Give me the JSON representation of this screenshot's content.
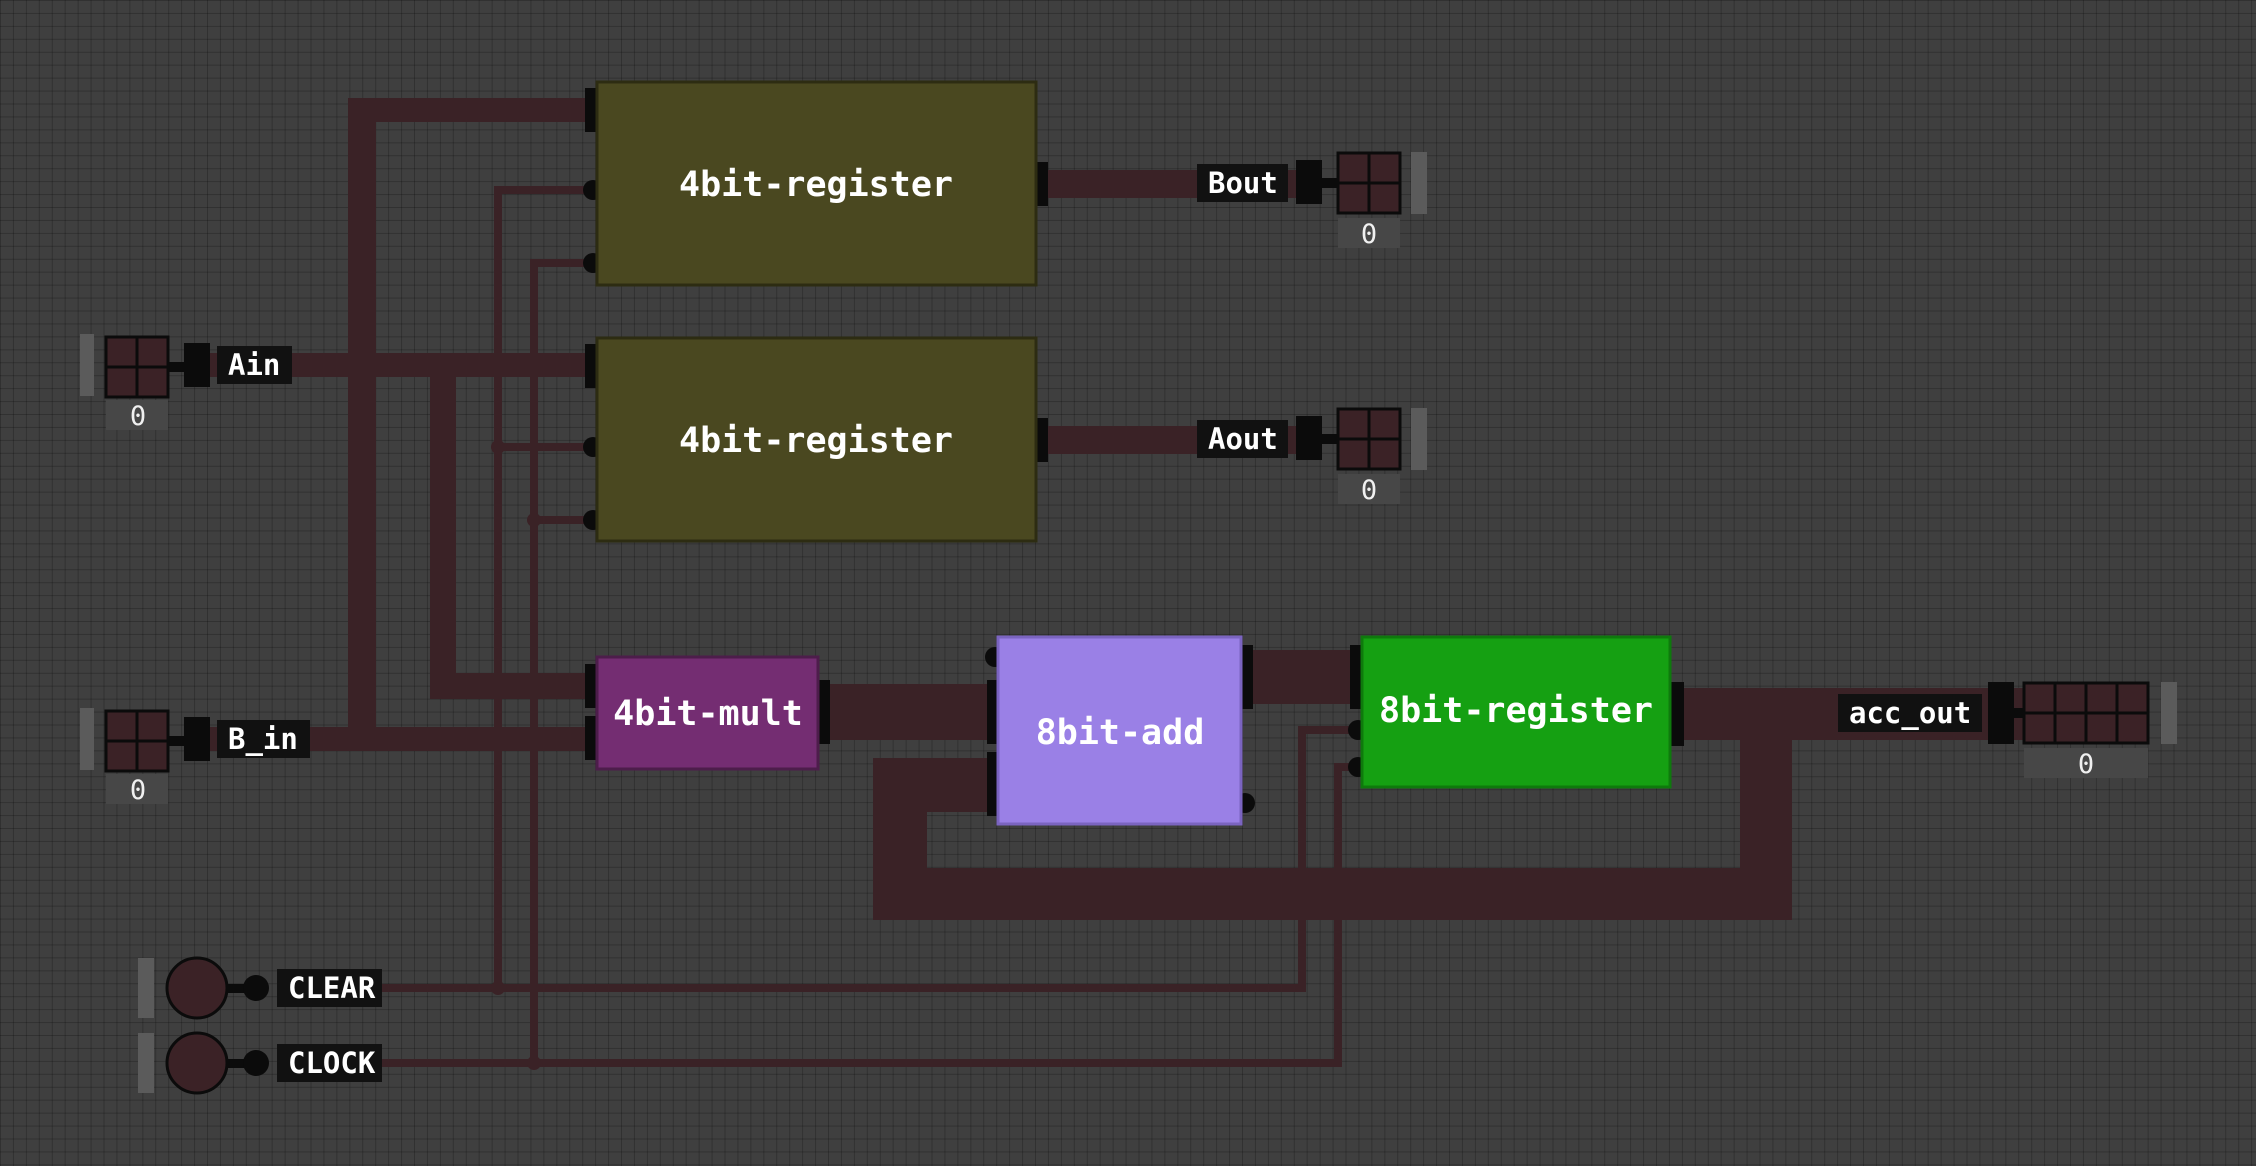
{
  "chips": {
    "reg_b": {
      "label": "4bit-register",
      "color": "#4a4820"
    },
    "reg_a": {
      "label": "4bit-register",
      "color": "#4a4820"
    },
    "mult": {
      "label": "4bit-mult",
      "color": "#742d72"
    },
    "add": {
      "label": "8bit-add",
      "color": "#9a80e6"
    },
    "acc": {
      "label": "8bit-register",
      "color": "#15a012"
    }
  },
  "inputs": {
    "ain": {
      "label": "Ain",
      "value": "0"
    },
    "bin": {
      "label": "B_in",
      "value": "0"
    },
    "clear": {
      "label": "CLEAR"
    },
    "clock": {
      "label": "CLOCK"
    }
  },
  "outputs": {
    "bout": {
      "label": "Bout",
      "value": "0"
    },
    "aout": {
      "label": "Aout",
      "value": "0"
    },
    "acc_out": {
      "label": "acc_out",
      "value": "0"
    }
  },
  "colors": {
    "wire": "#3a2226",
    "background": "#3f3f3f",
    "pin": "#0b0b0b"
  }
}
